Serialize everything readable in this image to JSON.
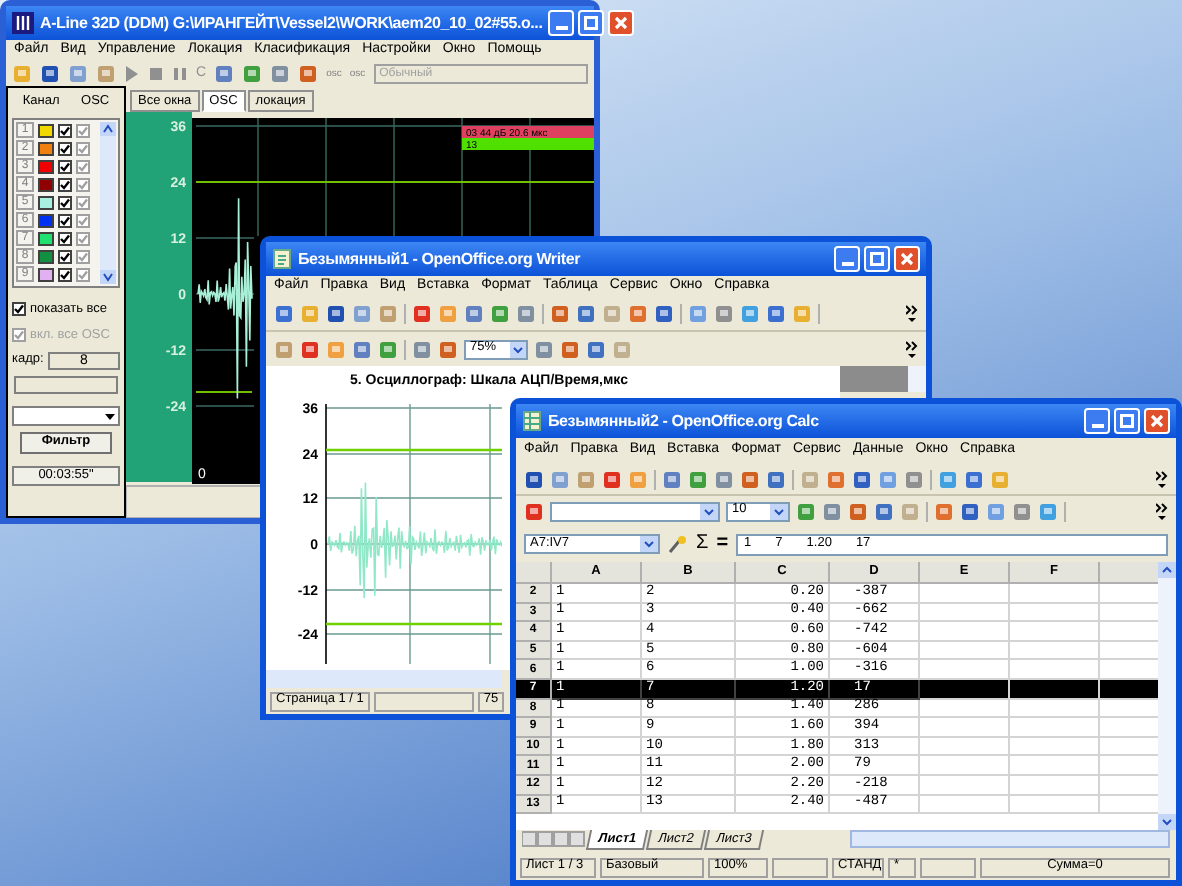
{
  "aline": {
    "title": "A-Line 32D (DDM)  G:\\ИРАНГЕЙТ\\Vessel2\\WORK\\aem20_10_02#55.o...",
    "menu": [
      "Файл",
      "Вид",
      "Управление",
      "Локация",
      "Класификация",
      "Настройки",
      "Окно",
      "Помощь"
    ],
    "toolbar": {
      "letter": "C",
      "osc_labels": [
        "osc",
        "osc"
      ],
      "mode": "Обычный"
    },
    "panel": {
      "headers": [
        "Канал",
        "OSC"
      ],
      "channels": [
        {
          "number": "1",
          "color": "#f0d800",
          "checked": true,
          "osc": true
        },
        {
          "number": "2",
          "color": "#f08010",
          "checked": true,
          "osc": true
        },
        {
          "number": "3",
          "color": "#f00000",
          "checked": true,
          "osc": true
        },
        {
          "number": "4",
          "color": "#900000",
          "checked": true,
          "osc": true
        },
        {
          "number": "5",
          "color": "#a8f0e0",
          "checked": true,
          "osc": true
        },
        {
          "number": "6",
          "color": "#0030f0",
          "checked": true,
          "osc": true
        },
        {
          "number": "7",
          "color": "#20e070",
          "checked": true,
          "osc": true
        },
        {
          "number": "8",
          "color": "#109040",
          "checked": true,
          "osc": true
        },
        {
          "number": "9",
          "color": "#e0b0f0",
          "checked": true,
          "osc": true
        }
      ],
      "options": [
        {
          "label": "показать все",
          "checked": true,
          "disabled": false
        },
        {
          "label": "вкл. все OSC",
          "checked": true,
          "disabled": true
        }
      ],
      "frame_label": "кадр:",
      "frame_value": "8",
      "filter_button": "Фильтр",
      "time": "00:03:55\""
    },
    "tabs": [
      {
        "label": "Все окна",
        "selected": false
      },
      {
        "label": "OSC",
        "selected": true
      },
      {
        "label": "локация",
        "selected": false
      }
    ],
    "chart": {
      "yticks": [
        "36",
        "24",
        "12",
        "0",
        "-12",
        "-24"
      ],
      "xtick": "0",
      "legend": [
        {
          "text": "03   44 дБ 20.6 мкс",
          "color": "#e04060"
        },
        {
          "text": "13",
          "color": "#50e000"
        }
      ]
    }
  },
  "writer": {
    "title": "Безымянный1 - OpenOffice.org Writer",
    "menu": [
      "Файл",
      "Правка",
      "Вид",
      "Вставка",
      "Формат",
      "Таблица",
      "Сервис",
      "Окно",
      "Справка"
    ],
    "zoom": "75%",
    "heading": "5. Осциллограф: Шкала АЦП/Время,мкс",
    "chart": {
      "yticks": [
        "36",
        "24",
        "12",
        "0",
        "-12",
        "-24"
      ]
    },
    "status": [
      "Страница 1 / 1",
      "75"
    ]
  },
  "calc": {
    "title": "Безымянный2 - OpenOffice.org Calc",
    "menu": [
      "Файл",
      "Правка",
      "Вид",
      "Вставка",
      "Формат",
      "Сервис",
      "Данные",
      "Окно",
      "Справка"
    ],
    "font_size": "10",
    "name_box": "A7:IV7",
    "sum_symbol": "Σ",
    "equals_symbol": "=",
    "formula": [
      "1",
      "7",
      "1.20",
      "17"
    ],
    "columns": [
      "A",
      "B",
      "C",
      "D",
      "E",
      "F"
    ],
    "rows": [
      {
        "number": "2",
        "cells": [
          "1",
          "2",
          "0.20",
          "-387"
        ],
        "selected": false
      },
      {
        "number": "3",
        "cells": [
          "1",
          "3",
          "0.40",
          "-662"
        ],
        "selected": false
      },
      {
        "number": "4",
        "cells": [
          "1",
          "4",
          "0.60",
          "-742"
        ],
        "selected": false
      },
      {
        "number": "5",
        "cells": [
          "1",
          "5",
          "0.80",
          "-604"
        ],
        "selected": false
      },
      {
        "number": "6",
        "cells": [
          "1",
          "6",
          "1.00",
          "-316"
        ],
        "selected": false
      },
      {
        "number": "7",
        "cells": [
          "1",
          "7",
          "1.20",
          "17"
        ],
        "selected": true
      },
      {
        "number": "8",
        "cells": [
          "1",
          "8",
          "1.40",
          "286"
        ],
        "selected": false
      },
      {
        "number": "9",
        "cells": [
          "1",
          "9",
          "1.60",
          "394"
        ],
        "selected": false
      },
      {
        "number": "10",
        "cells": [
          "1",
          "10",
          "1.80",
          "313"
        ],
        "selected": false
      },
      {
        "number": "11",
        "cells": [
          "1",
          "11",
          "2.00",
          "79"
        ],
        "selected": false
      },
      {
        "number": "12",
        "cells": [
          "1",
          "12",
          "2.20",
          "-218"
        ],
        "selected": false
      },
      {
        "number": "13",
        "cells": [
          "1",
          "13",
          "2.40",
          "-487"
        ],
        "selected": false
      }
    ],
    "sheets": [
      {
        "label": "Лист1",
        "selected": true
      },
      {
        "label": "Лист2",
        "selected": false
      },
      {
        "label": "Лист3",
        "selected": false
      }
    ],
    "status": [
      "Лист 1 / 3",
      "Базовый",
      "100%",
      "СТАНД",
      "*",
      "Сумма=0"
    ]
  }
}
